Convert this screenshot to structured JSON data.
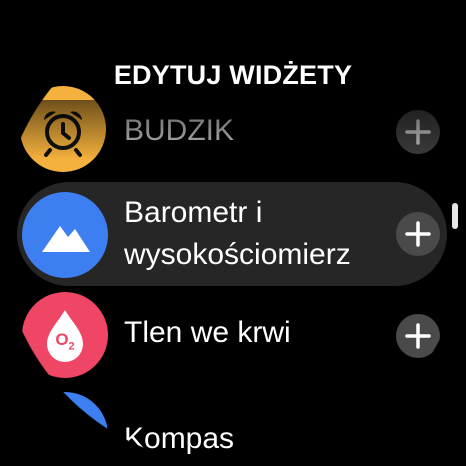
{
  "header": {
    "title": "EDYTUJ WIDŻETY"
  },
  "items": [
    {
      "label": "BUDZIK",
      "icon": "alarm-clock-icon",
      "color": "#f5b13d"
    },
    {
      "label_line1": "Barometr i",
      "label_line2": "wysokościomierz",
      "icon": "mountain-icon",
      "color": "#3d7ff1"
    },
    {
      "label": "Tlen we krwi",
      "icon": "blood-oxygen-icon",
      "icon_text": "O2",
      "color": "#ef4666"
    },
    {
      "label": "Kompas",
      "icon": "compass-icon",
      "color": "#3d7ff1"
    }
  ],
  "colors": {
    "add_button": "#4a4a4a",
    "highlight": "#262626"
  }
}
